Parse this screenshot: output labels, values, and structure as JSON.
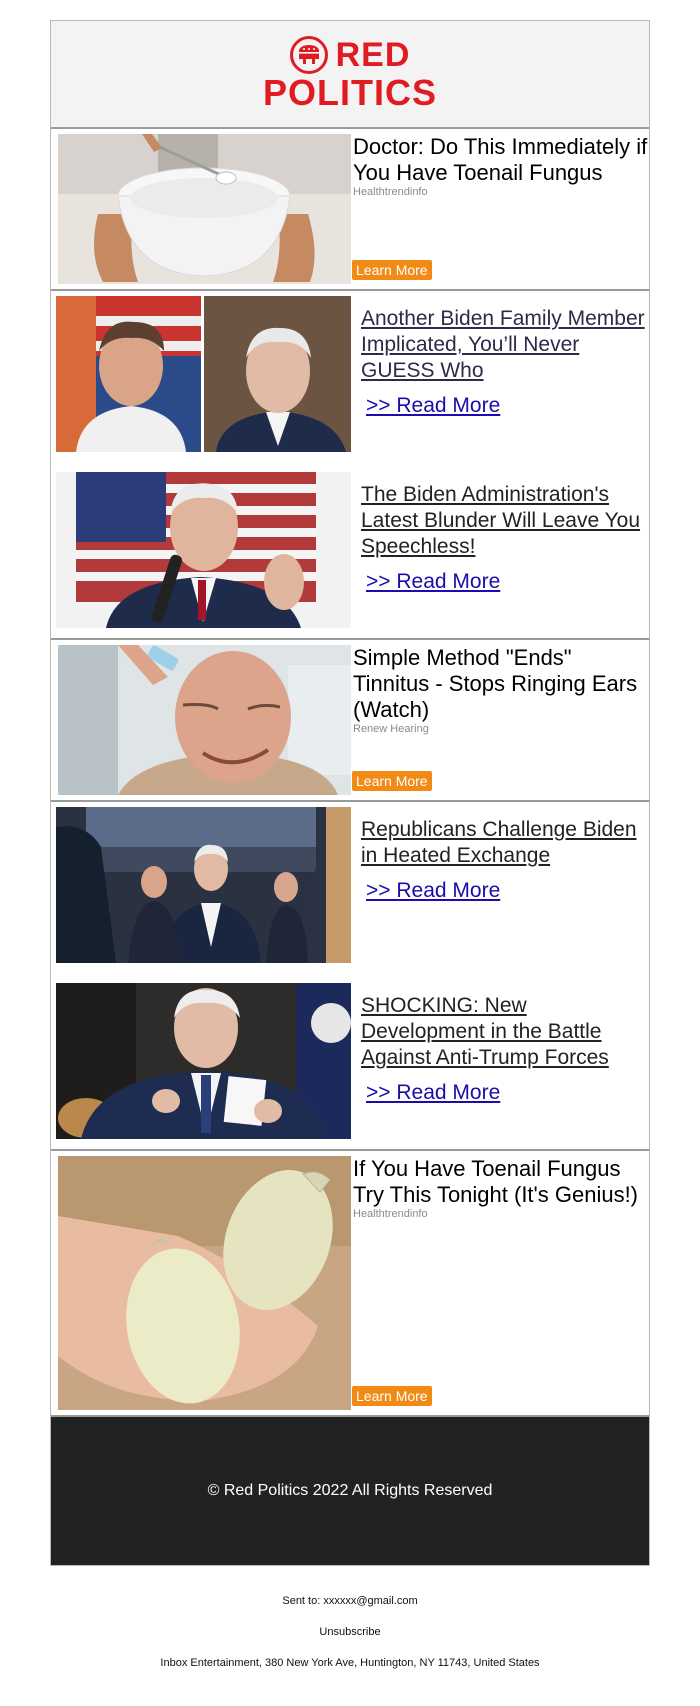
{
  "brand": {
    "line1": "RED",
    "line2": "POLITICS",
    "color": "#e11b22"
  },
  "ads": [
    {
      "title": "Doctor: Do This Immediately if You Have Toenail Fungus",
      "source": "Healthtrendinfo",
      "cta": "Learn More"
    },
    {
      "title": "Simple Method \"Ends\" Tinnitus - Stops Ringing Ears (Watch)",
      "source": "Renew Hearing",
      "cta": "Learn More"
    },
    {
      "title": "If You Have Toenail Fungus Try This Tonight (It's Genius!)",
      "source": "Healthtrendinfo",
      "cta": "Learn More"
    }
  ],
  "articles": [
    {
      "title": "Another Biden Family Member Implicated, You’ll Never GUESS Who",
      "read_more": ">> Read More"
    },
    {
      "title": "The Biden Administration's Latest Blunder Will Leave You Speechless!",
      "read_more": ">> Read More"
    },
    {
      "title": "Republicans Challenge Biden in Heated Exchange",
      "read_more": ">> Read More"
    },
    {
      "title": "SHOCKING: New Development in the Battle Against Anti-Trump Forces",
      "read_more": ">> Read More"
    }
  ],
  "footer": {
    "copyright": "© Red Politics 2022 All Rights Reserved",
    "sent_to": "Sent to: xxxxxx@gmail.com",
    "unsubscribe": "Unsubscribe",
    "address": "Inbox Entertainment, 380 New York Ave, Huntington, NY 11743, United States"
  },
  "colors": {
    "cta": "#f28b16",
    "link": "#1a0dab",
    "footer_bg": "#222222"
  }
}
